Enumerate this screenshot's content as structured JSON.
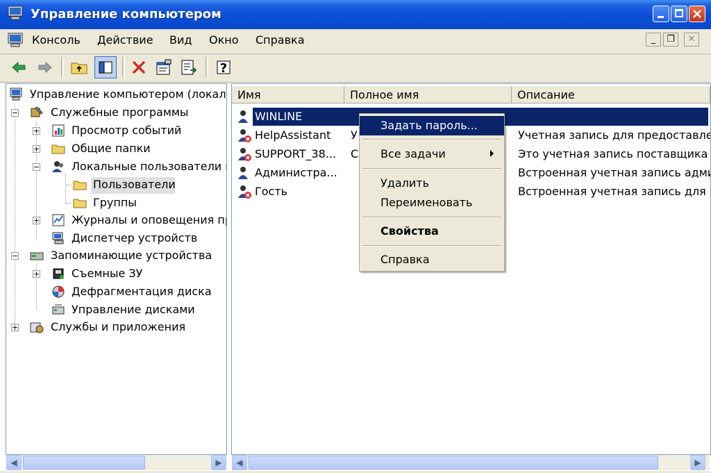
{
  "window": {
    "title": "Управление компьютером"
  },
  "menu": [
    "Консоль",
    "Действие",
    "Вид",
    "Окно",
    "Справка"
  ],
  "tree": {
    "root": "Управление компьютером (локаль",
    "items": [
      "Служебные программы",
      "Просмотр событий",
      "Общие папки",
      "Локальные пользователи и",
      "Пользователи",
      "Группы",
      "Журналы и оповещения пр",
      "Диспетчер устройств",
      "Запоминающие устройства",
      "Съемные ЗУ",
      "Дефрагментация диска",
      "Управление дисками",
      "Службы и приложения"
    ]
  },
  "list": {
    "columns": [
      "Имя",
      "Полное имя",
      "Описание"
    ],
    "rows": [
      {
        "name": "WINLINE",
        "full": "",
        "desc": ""
      },
      {
        "name": "HelpAssistant",
        "full": "У",
        "desc": "Учетная запись для предоставле"
      },
      {
        "name": "SUPPORT_38...",
        "full": "С",
        "desc": "Это учетная запись поставщика"
      },
      {
        "name": "Администра...",
        "full": "",
        "desc": "Встроенная учетная запись адми"
      },
      {
        "name": "Гость",
        "full": "",
        "desc": "Встроенная учетная запись для ,"
      }
    ]
  },
  "context_menu": {
    "set_password": "Задать пароль...",
    "all_tasks": "Все задачи",
    "delete": "Удалить",
    "rename": "Переименовать",
    "properties": "Свойства",
    "help": "Справка"
  },
  "colors": {
    "title_bar": "#0a4ed8",
    "selection": "#0a246a",
    "chrome": "#ece9d8"
  }
}
